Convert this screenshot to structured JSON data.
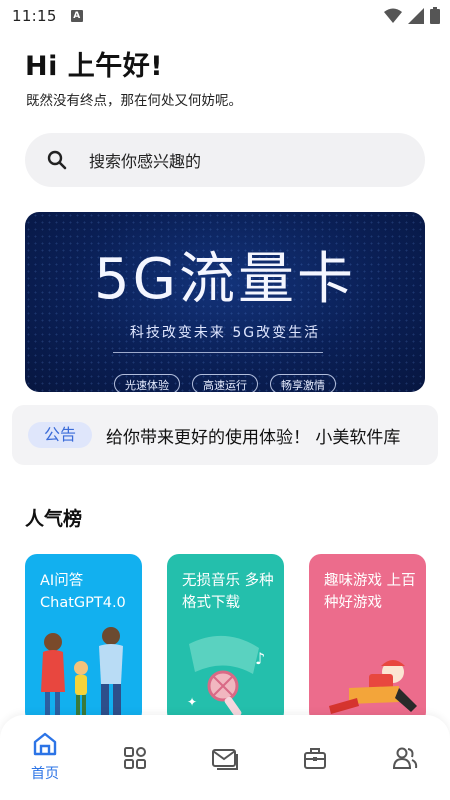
{
  "status_bar": {
    "time": "11:15",
    "notification_icon": "A"
  },
  "header": {
    "greeting": "Hi 上午好!",
    "subtitle": "既然没有终点，那在何处又何妨呢。"
  },
  "search": {
    "placeholder": "搜索你感兴趣的"
  },
  "banner": {
    "title": "5G流量卡",
    "subtitle": "科技改变未来 5G改变生活",
    "tags": [
      "光速体验",
      "高速运行",
      "畅享激情"
    ]
  },
  "notice": {
    "badge": "公告",
    "text": "给你带来更好的使用体验！   小美软件库"
  },
  "popular": {
    "title": "人气榜",
    "cards": [
      {
        "title": "AI问答 ChatGPT4.0",
        "color": "#12b0ef"
      },
      {
        "title": "无损音乐 多种格式下载",
        "color": "#24bfac"
      },
      {
        "title": "趣味游戏 上百种好游戏",
        "color": "#ec6c8c"
      }
    ]
  },
  "tabbar": {
    "active_color": "#2c74e6",
    "items": [
      {
        "icon": "home-icon",
        "label": "首页",
        "active": true
      },
      {
        "icon": "grid-icon",
        "label": ""
      },
      {
        "icon": "mail-icon",
        "label": ""
      },
      {
        "icon": "toolbox-icon",
        "label": ""
      },
      {
        "icon": "users-icon",
        "label": ""
      }
    ]
  }
}
